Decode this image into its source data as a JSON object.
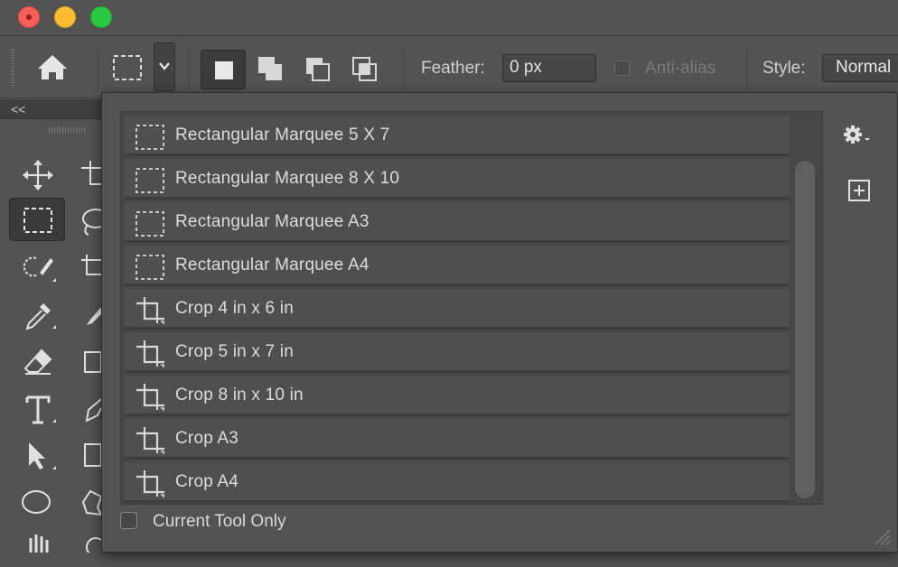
{
  "window": {
    "controls": [
      "close",
      "minimize",
      "zoom"
    ]
  },
  "options_bar": {
    "home_icon": "home-icon",
    "tool_icon": "rectangular-marquee-icon",
    "preset_dropdown_icon": "chevron-down-icon",
    "selection_modes": [
      "new-selection-icon",
      "add-to-selection-icon",
      "subtract-from-selection-icon",
      "intersect-selection-icon"
    ],
    "feather_label": "Feather:",
    "feather_value": "0 px",
    "antialias_label": "Anti-alias",
    "style_label": "Style:",
    "style_value": "Normal"
  },
  "toolbar": {
    "collapse_label": "<<"
  },
  "preset_picker": {
    "items": [
      {
        "label": "Rectangular Marquee 5 X 7",
        "icon": "rectangular-marquee-icon"
      },
      {
        "label": "Rectangular Marquee 8 X 10",
        "icon": "rectangular-marquee-icon"
      },
      {
        "label": "Rectangular Marquee A3",
        "icon": "rectangular-marquee-icon"
      },
      {
        "label": "Rectangular Marquee A4",
        "icon": "rectangular-marquee-icon"
      },
      {
        "label": "Crop 4 in x 6 in",
        "icon": "crop-icon"
      },
      {
        "label": "Crop 5 in x 7 in",
        "icon": "crop-icon"
      },
      {
        "label": "Crop 8 in x 10 in",
        "icon": "crop-icon"
      },
      {
        "label": "Crop A3",
        "icon": "crop-icon"
      },
      {
        "label": "Crop A4",
        "icon": "crop-icon"
      }
    ],
    "current_tool_only_label": "Current Tool Only",
    "current_tool_only_checked": false
  },
  "colors": {
    "panel_bg": "#535353",
    "list_bg": "#474747",
    "row_bg": "#4f4f4f",
    "close": "#ff5f57",
    "minimize": "#febc2e",
    "zoom": "#28c840"
  }
}
